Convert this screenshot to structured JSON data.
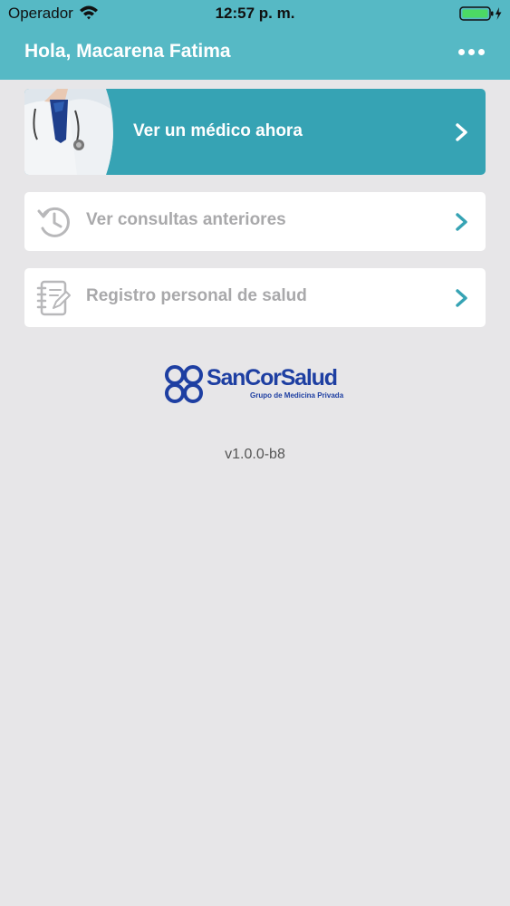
{
  "status_bar": {
    "carrier": "Operador",
    "time": "12:57 p. m.",
    "icons": [
      "wifi-icon",
      "battery-icon",
      "charging-bolt-icon"
    ]
  },
  "header": {
    "greeting": "Hola, Macarena Fatima",
    "menu_icon": "more-horizontal-icon",
    "color": "#56b9c5"
  },
  "menu": {
    "items": [
      {
        "label": "Ver un médico ahora",
        "icon": "doctor-photo",
        "color": "#36a3b4"
      },
      {
        "label": "Ver consultas anteriores",
        "icon": "history-clock-icon"
      },
      {
        "label": "Registro personal de salud",
        "icon": "health-notebook-icon"
      }
    ],
    "chevron_icon": "chevron-right-icon",
    "chevron_color": "#36a3b4"
  },
  "branding": {
    "name": "SanCorSalud",
    "tagline": "Grupo de Medicina Privada",
    "color": "#1e3fa2"
  },
  "app": {
    "version": "v1.0.0-b8"
  }
}
